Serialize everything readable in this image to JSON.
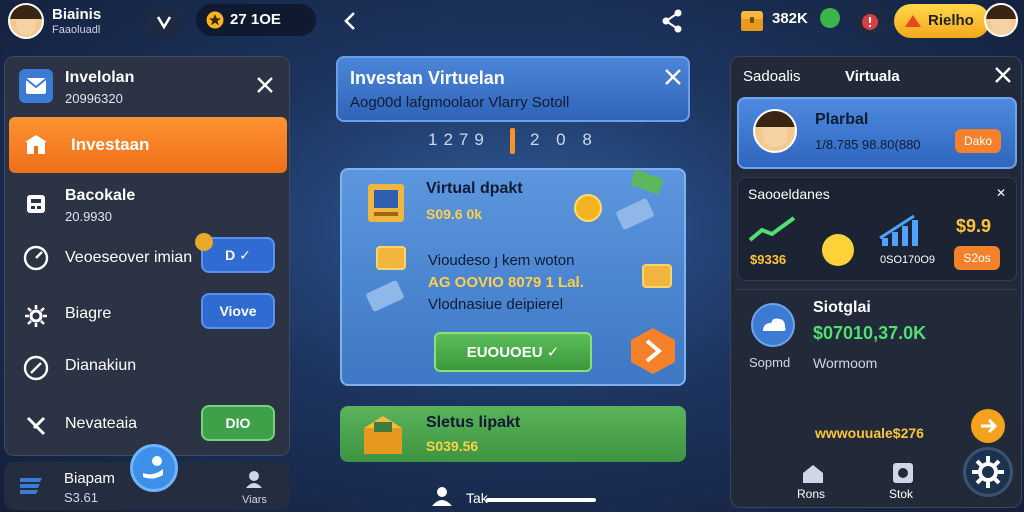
{
  "topbar": {
    "username": "Biainis",
    "user_sub": "Faaoluadl",
    "coins": "27 1OE",
    "right_amount": "382K",
    "cta_label": "Rielho"
  },
  "left": {
    "header_title": "Invelolan",
    "header_sub": "20996320",
    "active_item": "Investaan",
    "items": [
      {
        "label": "Bacokale",
        "sub": "20.9930"
      },
      {
        "label": "Veoeseover imian",
        "button": "D ✓"
      },
      {
        "label": "Biagre",
        "button": "Viove"
      },
      {
        "label": "Dianakiun"
      },
      {
        "label": "Nevateaia",
        "button": "DIO"
      }
    ],
    "bottom_tab_title": "Biapam",
    "bottom_tab_sub": "S3.61",
    "bottom_tab_right": "Viars"
  },
  "center": {
    "header_title": "Investan Virtuelan",
    "header_sub": "Aog00d lafgmoolaor Vlarry Sotoll",
    "stats_left": "1279",
    "stats_right": "2 0 8",
    "card_title": "Virtual dpakt",
    "card_amount": "S09.6 0k",
    "card_line1": "Vioudeso ȷ kem woton",
    "card_line2": "AG OOVIO 8079 1 Lal.",
    "card_line3": "Vlodnasiue deipierel",
    "card_button": "EUOUOEU ✓",
    "status_title": "Sletus lipakt",
    "status_amount": "S039.56",
    "bottom_label": "Tak"
  },
  "right": {
    "tab1": "Sadoalis",
    "tab2": "Virtuala",
    "profile_title": "Plarbal",
    "profile_sub": "1/8.785 98.80(880",
    "profile_btn": "Dako",
    "section_title": "Saooeldanes",
    "stat1_value": "$9336",
    "stat2_label": "0SO170O9",
    "stat3_value": "$9.9",
    "stat3_btn": "S2os",
    "sig_title": "Siotglai",
    "sig_amount": "$07010,37.0K",
    "sig_left": "Sopmd",
    "sig_right": "Wormoom",
    "promo_text": "wwwouuale$276",
    "nav1": "Rons",
    "nav2": "Stok"
  },
  "colors": {
    "accent_orange": "#f5822a",
    "accent_blue": "#3f7ed6",
    "accent_green": "#48a948",
    "gold": "#ffc53a"
  },
  "icons": [
    "avatar-icon",
    "v-icon",
    "star-coin-icon",
    "share-icon",
    "share-icon-right",
    "treasure-chest-icon",
    "close-icon",
    "gear-icon",
    "arrow-icon",
    "chart-icon",
    "wallet-icon"
  ]
}
